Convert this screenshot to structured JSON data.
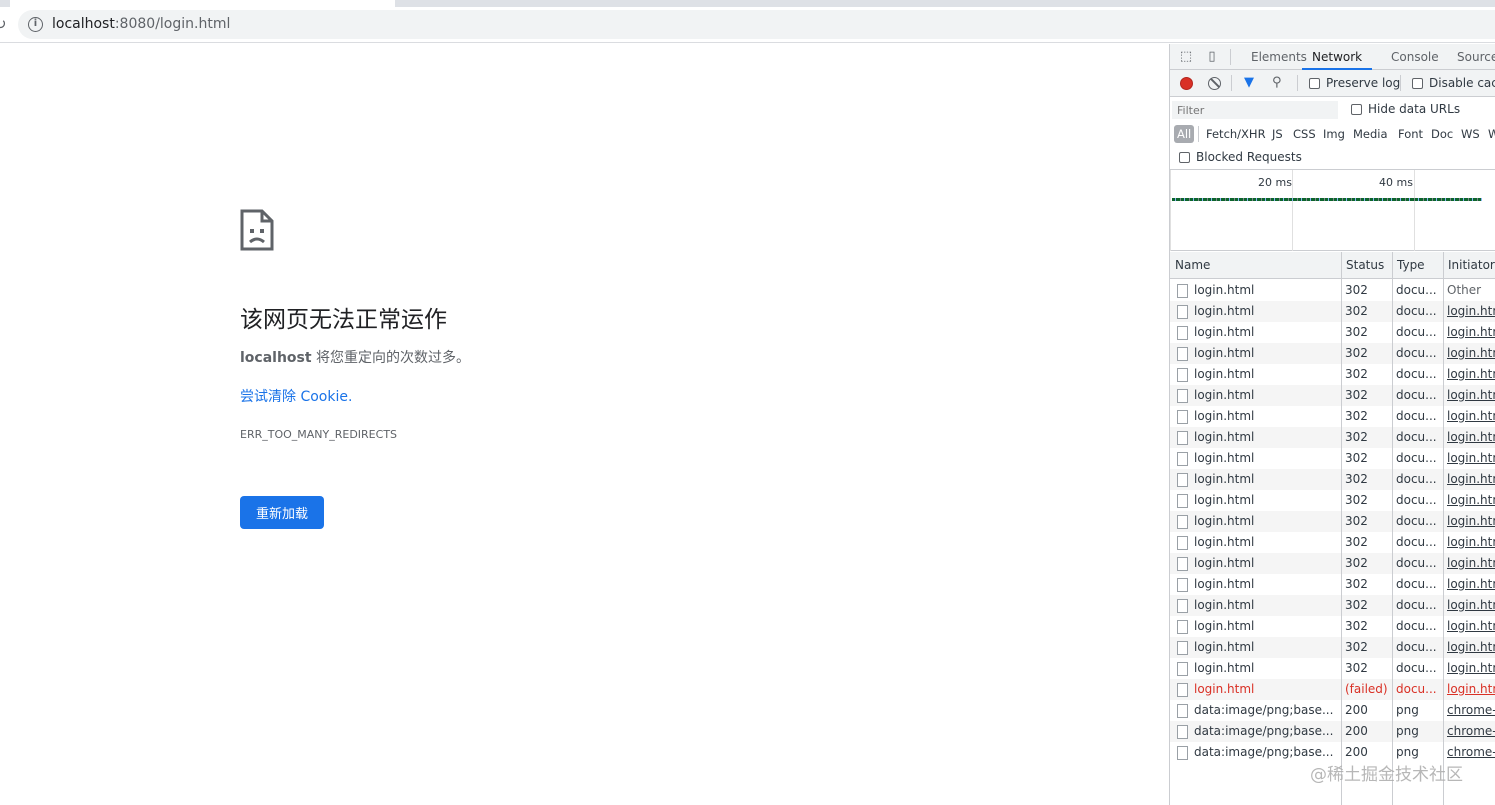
{
  "browser": {
    "url_host": "localhost",
    "url_rest": ":8080/login.html"
  },
  "error_page": {
    "title": "该网页无法正常运作",
    "message_host": "localhost",
    "message_text": " 将您重定向的次数过多。",
    "link": "尝试清除 Cookie.",
    "code": "ERR_TOO_MANY_REDIRECTS",
    "reload_button": "重新加载"
  },
  "devtools": {
    "tabs": [
      "Elements",
      "Network",
      "Console",
      "Sources"
    ],
    "active_tab": "Network",
    "preserve_log": "Preserve log",
    "disable_cache": "Disable cache",
    "filter_placeholder": "Filter",
    "hide_data_urls": "Hide data URLs",
    "types": [
      "All",
      "Fetch/XHR",
      "JS",
      "CSS",
      "Img",
      "Media",
      "Font",
      "Doc",
      "WS",
      "W"
    ],
    "blocked_requests": "Blocked Requests",
    "overview_labels": [
      "20 ms",
      "40 ms"
    ],
    "columns": [
      "Name",
      "Status",
      "Type",
      "Initiator"
    ],
    "rows": [
      {
        "name": "login.html",
        "status": "302",
        "type": "docu...",
        "initiator": "Other"
      },
      {
        "name": "login.html",
        "status": "302",
        "type": "docu...",
        "initiator": "login.htm"
      },
      {
        "name": "login.html",
        "status": "302",
        "type": "docu...",
        "initiator": "login.htm"
      },
      {
        "name": "login.html",
        "status": "302",
        "type": "docu...",
        "initiator": "login.htm"
      },
      {
        "name": "login.html",
        "status": "302",
        "type": "docu...",
        "initiator": "login.htm"
      },
      {
        "name": "login.html",
        "status": "302",
        "type": "docu...",
        "initiator": "login.htm"
      },
      {
        "name": "login.html",
        "status": "302",
        "type": "docu...",
        "initiator": "login.htm"
      },
      {
        "name": "login.html",
        "status": "302",
        "type": "docu...",
        "initiator": "login.htm"
      },
      {
        "name": "login.html",
        "status": "302",
        "type": "docu...",
        "initiator": "login.htm"
      },
      {
        "name": "login.html",
        "status": "302",
        "type": "docu...",
        "initiator": "login.htm"
      },
      {
        "name": "login.html",
        "status": "302",
        "type": "docu...",
        "initiator": "login.htm"
      },
      {
        "name": "login.html",
        "status": "302",
        "type": "docu...",
        "initiator": "login.htm"
      },
      {
        "name": "login.html",
        "status": "302",
        "type": "docu...",
        "initiator": "login.htm"
      },
      {
        "name": "login.html",
        "status": "302",
        "type": "docu...",
        "initiator": "login.htm"
      },
      {
        "name": "login.html",
        "status": "302",
        "type": "docu...",
        "initiator": "login.htm"
      },
      {
        "name": "login.html",
        "status": "302",
        "type": "docu...",
        "initiator": "login.htm"
      },
      {
        "name": "login.html",
        "status": "302",
        "type": "docu...",
        "initiator": "login.htm"
      },
      {
        "name": "login.html",
        "status": "302",
        "type": "docu...",
        "initiator": "login.htm"
      },
      {
        "name": "login.html",
        "status": "302",
        "type": "docu...",
        "initiator": "login.htm"
      },
      {
        "name": "login.html",
        "status": "(failed)",
        "type": "docu...",
        "initiator": "login.htm"
      },
      {
        "name": "data:image/png;base...",
        "status": "200",
        "type": "png",
        "initiator": "chrome-e"
      },
      {
        "name": "data:image/png;base...",
        "status": "200",
        "type": "png",
        "initiator": "chrome-e"
      },
      {
        "name": "data:image/png;base...",
        "status": "200",
        "type": "png",
        "initiator": "chrome-e"
      }
    ]
  },
  "watermark": "@稀土掘金技术社区"
}
